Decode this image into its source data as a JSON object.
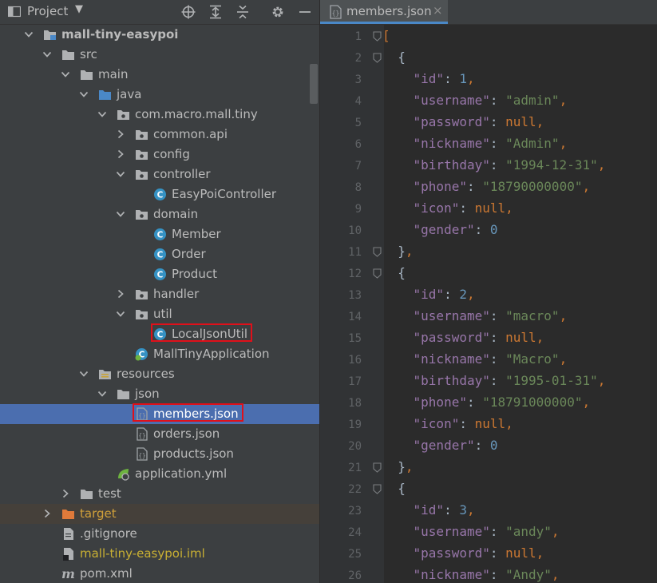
{
  "project_panel": {
    "title": "Project",
    "tree": [
      {
        "label": "mall-tiny-easypoi",
        "depth": 0,
        "arrow": "down",
        "icon": "module",
        "bold": true
      },
      {
        "label": "src",
        "depth": 1,
        "arrow": "down",
        "icon": "folder"
      },
      {
        "label": "main",
        "depth": 2,
        "arrow": "down",
        "icon": "folder"
      },
      {
        "label": "java",
        "depth": 3,
        "arrow": "down",
        "icon": "source-folder"
      },
      {
        "label": "com.macro.mall.tiny",
        "depth": 4,
        "arrow": "down",
        "icon": "package"
      },
      {
        "label": "common.api",
        "depth": 5,
        "arrow": "right",
        "icon": "package"
      },
      {
        "label": "config",
        "depth": 5,
        "arrow": "right",
        "icon": "package"
      },
      {
        "label": "controller",
        "depth": 5,
        "arrow": "down",
        "icon": "package"
      },
      {
        "label": "EasyPoiController",
        "depth": 6,
        "arrow": "none",
        "icon": "class"
      },
      {
        "label": "domain",
        "depth": 5,
        "arrow": "down",
        "icon": "package"
      },
      {
        "label": "Member",
        "depth": 6,
        "arrow": "none",
        "icon": "class"
      },
      {
        "label": "Order",
        "depth": 6,
        "arrow": "none",
        "icon": "class"
      },
      {
        "label": "Product",
        "depth": 6,
        "arrow": "none",
        "icon": "class"
      },
      {
        "label": "handler",
        "depth": 5,
        "arrow": "right",
        "icon": "package"
      },
      {
        "label": "util",
        "depth": 5,
        "arrow": "down",
        "icon": "package"
      },
      {
        "label": "LocalJsonUtil",
        "depth": 6,
        "arrow": "none",
        "icon": "class",
        "highlight": true
      },
      {
        "label": "MallTinyApplication",
        "depth": 5,
        "arrow": "none",
        "icon": "spring-class"
      },
      {
        "label": "resources",
        "depth": 3,
        "arrow": "down",
        "icon": "resources-folder"
      },
      {
        "label": "json",
        "depth": 4,
        "arrow": "down",
        "icon": "folder"
      },
      {
        "label": "members.json",
        "depth": 5,
        "arrow": "none",
        "icon": "json-file",
        "selected": true,
        "highlight": true
      },
      {
        "label": "orders.json",
        "depth": 5,
        "arrow": "none",
        "icon": "json-file"
      },
      {
        "label": "products.json",
        "depth": 5,
        "arrow": "none",
        "icon": "json-file"
      },
      {
        "label": "application.yml",
        "depth": 4,
        "arrow": "none",
        "icon": "spring-yml"
      },
      {
        "label": "test",
        "depth": 2,
        "arrow": "right",
        "icon": "folder"
      },
      {
        "label": "target",
        "depth": 1,
        "arrow": "right",
        "icon": "excluded-folder",
        "excluded": true
      },
      {
        "label": ".gitignore",
        "depth": 1,
        "arrow": "none",
        "icon": "text-file"
      },
      {
        "label": "mall-tiny-easypoi.iml",
        "depth": 1,
        "arrow": "none",
        "icon": "iml-file",
        "excluded_text": true
      },
      {
        "label": "pom.xml",
        "depth": 1,
        "arrow": "none",
        "icon": "maven-file"
      }
    ]
  },
  "editor": {
    "tab_label": "members.json",
    "tab_close": "×",
    "lines": [
      [
        [
          "p",
          "["
        ]
      ],
      [
        [
          "t",
          "  {"
        ]
      ],
      [
        [
          "t",
          "    "
        ],
        [
          "k",
          "\"id\""
        ],
        [
          "t",
          ": "
        ],
        [
          "n",
          "1"
        ],
        [
          "p",
          ","
        ]
      ],
      [
        [
          "t",
          "    "
        ],
        [
          "k",
          "\"username\""
        ],
        [
          "t",
          ": "
        ],
        [
          "s",
          "\"admin\""
        ],
        [
          "p",
          ","
        ]
      ],
      [
        [
          "t",
          "    "
        ],
        [
          "k",
          "\"password\""
        ],
        [
          "t",
          ": "
        ],
        [
          "kw",
          "null"
        ],
        [
          "p",
          ","
        ]
      ],
      [
        [
          "t",
          "    "
        ],
        [
          "k",
          "\"nickname\""
        ],
        [
          "t",
          ": "
        ],
        [
          "s",
          "\"Admin\""
        ],
        [
          "p",
          ","
        ]
      ],
      [
        [
          "t",
          "    "
        ],
        [
          "k",
          "\"birthday\""
        ],
        [
          "t",
          ": "
        ],
        [
          "s",
          "\"1994-12-31\""
        ],
        [
          "p",
          ","
        ]
      ],
      [
        [
          "t",
          "    "
        ],
        [
          "k",
          "\"phone\""
        ],
        [
          "t",
          ": "
        ],
        [
          "s",
          "\"18790000000\""
        ],
        [
          "p",
          ","
        ]
      ],
      [
        [
          "t",
          "    "
        ],
        [
          "k",
          "\"icon\""
        ],
        [
          "t",
          ": "
        ],
        [
          "kw",
          "null"
        ],
        [
          "p",
          ","
        ]
      ],
      [
        [
          "t",
          "    "
        ],
        [
          "k",
          "\"gender\""
        ],
        [
          "t",
          ": "
        ],
        [
          "n",
          "0"
        ]
      ],
      [
        [
          "t",
          "  }"
        ],
        [
          "p",
          ","
        ]
      ],
      [
        [
          "t",
          "  {"
        ]
      ],
      [
        [
          "t",
          "    "
        ],
        [
          "k",
          "\"id\""
        ],
        [
          "t",
          ": "
        ],
        [
          "n",
          "2"
        ],
        [
          "p",
          ","
        ]
      ],
      [
        [
          "t",
          "    "
        ],
        [
          "k",
          "\"username\""
        ],
        [
          "t",
          ": "
        ],
        [
          "s",
          "\"macro\""
        ],
        [
          "p",
          ","
        ]
      ],
      [
        [
          "t",
          "    "
        ],
        [
          "k",
          "\"password\""
        ],
        [
          "t",
          ": "
        ],
        [
          "kw",
          "null"
        ],
        [
          "p",
          ","
        ]
      ],
      [
        [
          "t",
          "    "
        ],
        [
          "k",
          "\"nickname\""
        ],
        [
          "t",
          ": "
        ],
        [
          "s",
          "\"Macro\""
        ],
        [
          "p",
          ","
        ]
      ],
      [
        [
          "t",
          "    "
        ],
        [
          "k",
          "\"birthday\""
        ],
        [
          "t",
          ": "
        ],
        [
          "s",
          "\"1995-01-31\""
        ],
        [
          "p",
          ","
        ]
      ],
      [
        [
          "t",
          "    "
        ],
        [
          "k",
          "\"phone\""
        ],
        [
          "t",
          ": "
        ],
        [
          "s",
          "\"18791000000\""
        ],
        [
          "p",
          ","
        ]
      ],
      [
        [
          "t",
          "    "
        ],
        [
          "k",
          "\"icon\""
        ],
        [
          "t",
          ": "
        ],
        [
          "kw",
          "null"
        ],
        [
          "p",
          ","
        ]
      ],
      [
        [
          "t",
          "    "
        ],
        [
          "k",
          "\"gender\""
        ],
        [
          "t",
          ": "
        ],
        [
          "n",
          "0"
        ]
      ],
      [
        [
          "t",
          "  }"
        ],
        [
          "p",
          ","
        ]
      ],
      [
        [
          "t",
          "  {"
        ]
      ],
      [
        [
          "t",
          "    "
        ],
        [
          "k",
          "\"id\""
        ],
        [
          "t",
          ": "
        ],
        [
          "n",
          "3"
        ],
        [
          "p",
          ","
        ]
      ],
      [
        [
          "t",
          "    "
        ],
        [
          "k",
          "\"username\""
        ],
        [
          "t",
          ": "
        ],
        [
          "s",
          "\"andy\""
        ],
        [
          "p",
          ","
        ]
      ],
      [
        [
          "t",
          "    "
        ],
        [
          "k",
          "\"password\""
        ],
        [
          "t",
          ": "
        ],
        [
          "kw",
          "null"
        ],
        [
          "p",
          ","
        ]
      ],
      [
        [
          "t",
          "    "
        ],
        [
          "k",
          "\"nickname\""
        ],
        [
          "t",
          ": "
        ],
        [
          "s",
          "\"Andy\""
        ],
        [
          "p",
          ","
        ]
      ]
    ],
    "fold_lines": [
      1,
      2,
      11,
      12,
      21,
      22
    ]
  },
  "colors": {
    "selection": "#4b6eaf",
    "highlight_box": "#e0101a",
    "json_key": "#9876aa",
    "json_string": "#6a8759",
    "json_number": "#6897bb",
    "json_keyword": "#cc7832"
  }
}
